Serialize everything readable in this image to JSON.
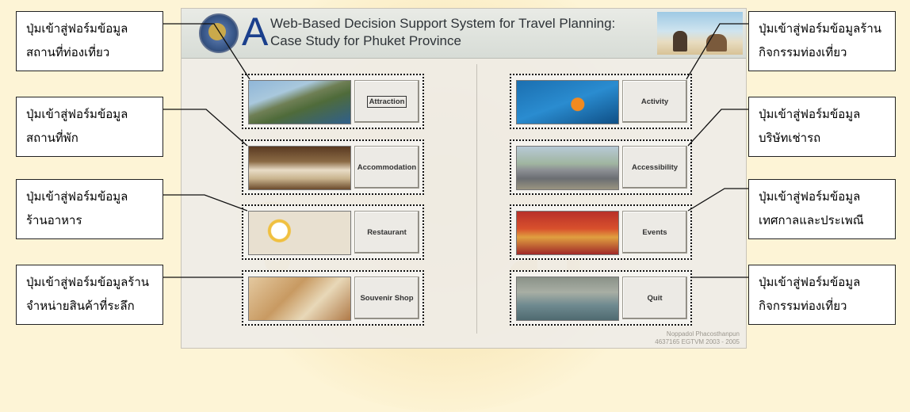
{
  "app": {
    "logo_letter": "A",
    "title_line1": "Web-Based Decision Support System for Travel Planning:",
    "title_line2": "Case Study for Phuket Province",
    "signature_line1": "Noppadol  Phacosthanpun",
    "signature_line2": "4637165 EGTVM 2003 - 2005"
  },
  "menu": {
    "left": [
      {
        "label": "Attraction",
        "icon": "coast-photo"
      },
      {
        "label": "Accommodation",
        "icon": "hotel-room-photo"
      },
      {
        "label": "Restaurant",
        "icon": "food-photo"
      },
      {
        "label": "Souvenir Shop",
        "icon": "souvenir-photo"
      }
    ],
    "right": [
      {
        "label": "Activity",
        "icon": "diving-photo"
      },
      {
        "label": "Accessibility",
        "icon": "van-photo"
      },
      {
        "label": "Events",
        "icon": "festival-photo"
      },
      {
        "label": "Quit",
        "icon": "cave-boat-photo"
      }
    ]
  },
  "callouts": {
    "left": [
      {
        "line1": "ปุ่มเข้าสู่ฟอร์มข้อมูล",
        "line2": "สถานที่ท่องเที่ยว"
      },
      {
        "line1": "ปุ่มเข้าสู่ฟอร์มข้อมูล",
        "line2": "สถานที่พัก"
      },
      {
        "line1": "ปุ่มเข้าสู่ฟอร์มข้อมูล",
        "line2": "ร้านอาหาร"
      },
      {
        "line1": "ปุ่มเข้าสู่ฟอร์มข้อมูลร้าน",
        "line2": "จำหน่ายสินค้าที่ระลึก"
      }
    ],
    "right": [
      {
        "line1": "ปุ่มเข้าสู่ฟอร์มข้อมูลร้าน",
        "line2": "กิจกรรมท่องเที่ยว"
      },
      {
        "line1": "ปุ่มเข้าสู่ฟอร์มข้อมูล",
        "line2": "บริษัทเช่ารถ"
      },
      {
        "line1": "ปุ่มเข้าสู่ฟอร์มข้อมูล",
        "line2": "เทศกาลและประเพณี"
      },
      {
        "line1": "ปุ่มเข้าสู่ฟอร์มข้อมูล",
        "line2": "กิจกรรมท่องเที่ยว"
      }
    ]
  },
  "colors": {
    "page_background": "#fdf4d6",
    "title_blue": "#1a3f8c",
    "window_gray": "#eeece8"
  }
}
